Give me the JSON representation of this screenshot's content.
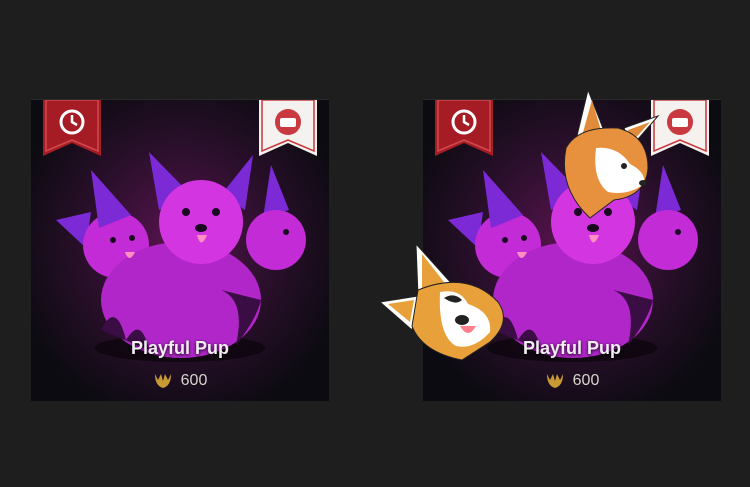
{
  "items": [
    {
      "name": "Playful Pup",
      "price": "600",
      "currency_icon": "champion-token-icon"
    },
    {
      "name": "Playful Pup",
      "price": "600",
      "currency_icon": "champion-token-icon"
    }
  ],
  "colors": {
    "background": "#1e1e1e",
    "banner_red": "#a51c24",
    "pup_magenta": "#c22bd6",
    "pup_purple": "#7b2ad6",
    "gold": "#c99a34"
  }
}
